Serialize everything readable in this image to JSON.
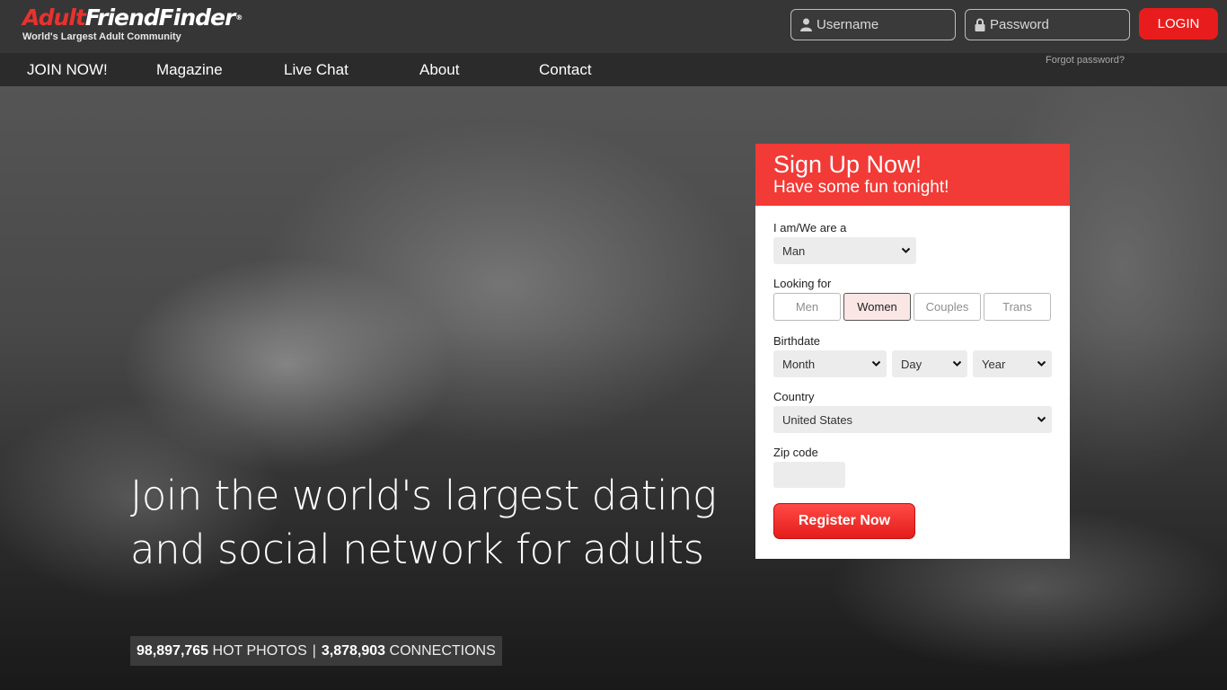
{
  "header": {
    "logo_part1": "Adult",
    "logo_part2": "FriendFinder",
    "logo_reg": "®",
    "tagline": "World's Largest Adult Community",
    "username_placeholder": "Username",
    "password_placeholder": "Password",
    "login_label": "LOGIN",
    "forgot_password": "Forgot password?"
  },
  "nav": {
    "items": [
      {
        "label": "JOIN NOW!"
      },
      {
        "label": "Magazine"
      },
      {
        "label": "Live Chat"
      },
      {
        "label": "About"
      },
      {
        "label": "Contact"
      }
    ]
  },
  "hero": {
    "headline": "Join the world's largest dating and social network for adults",
    "photos_count": "98,897,765",
    "photos_label": "HOT PHOTOS",
    "separator": "|",
    "connections_count": "3,878,903",
    "connections_label": "CONNECTIONS"
  },
  "signup": {
    "title": "Sign Up Now!",
    "subtitle": "Have some fun tonight!",
    "iam_label": "I am/We are a",
    "iam_value": "Man",
    "looking_label": "Looking for",
    "looking_options": [
      "Men",
      "Women",
      "Couples",
      "Trans"
    ],
    "looking_selected": "Women",
    "birthdate_label": "Birthdate",
    "month_value": "Month",
    "day_value": "Day",
    "year_value": "Year",
    "country_label": "Country",
    "country_value": "United States",
    "zip_label": "Zip code",
    "register_label": "Register Now"
  },
  "colors": {
    "brand_red": "#e81c1c",
    "header_bg": "#363636",
    "nav_bg": "#2b2b2b",
    "signup_header": "#f23a36"
  }
}
